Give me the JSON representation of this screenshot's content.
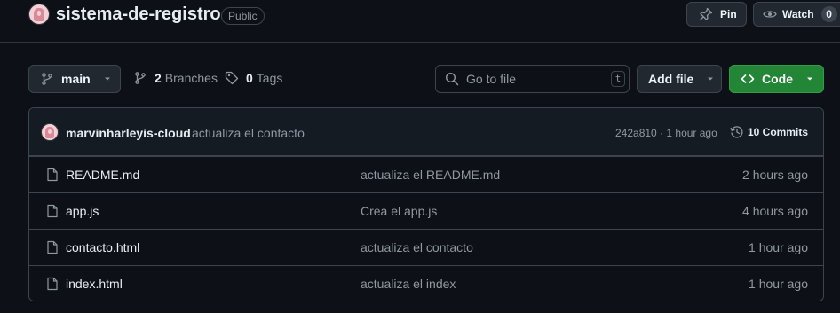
{
  "repo": {
    "name": "sistema-de-registro",
    "visibility": "Public"
  },
  "actions": {
    "pin_label": "Pin",
    "watch_label": "Watch",
    "watch_count": "0"
  },
  "toolbar": {
    "branch": "main",
    "branches_count": "2",
    "branches_label": "Branches",
    "tags_count": "0",
    "tags_label": "Tags",
    "search_placeholder": "Go to file",
    "search_shortcut": "t",
    "add_file_label": "Add file",
    "code_label": "Code"
  },
  "latest_commit": {
    "author": "marvinharleyis-cloud",
    "message": "actualiza el contacto",
    "meta": "242a810 · 1 hour ago",
    "commits_label": "10 Commits"
  },
  "files": [
    {
      "name": "README.md",
      "message": "actualiza el README.md",
      "time": "2 hours ago",
      "icon": "file-icon"
    },
    {
      "name": "app.js",
      "message": "Crea el app.js",
      "time": "4 hours ago",
      "icon": "file-icon"
    },
    {
      "name": "contacto.html",
      "message": "actualiza el contacto",
      "time": "1 hour ago",
      "icon": "file-icon"
    },
    {
      "name": "index.html",
      "message": "actualiza el index",
      "time": "1 hour ago",
      "icon": "file-icon"
    }
  ],
  "colors": {
    "background": "#0d1117",
    "border": "#3d444d",
    "code_button": "#238636",
    "muted_text": "#9198a1"
  }
}
